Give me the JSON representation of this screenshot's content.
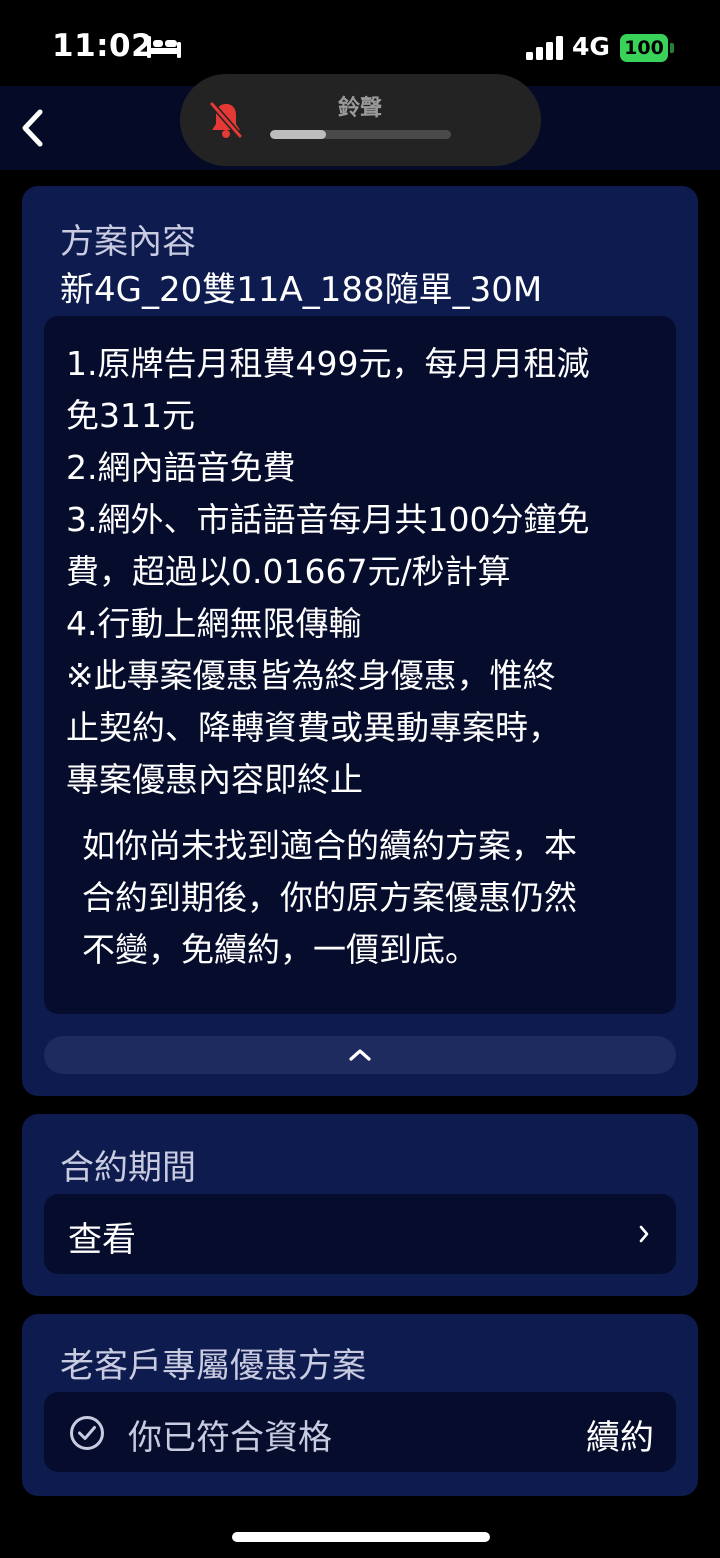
{
  "status_bar": {
    "time": "11:02",
    "network": "4G",
    "battery": "100",
    "battery_color": "#3ad35a"
  },
  "ringer": {
    "label": "鈴聲",
    "volume_fraction": 0.31
  },
  "plan": {
    "section_title": "方案內容",
    "name": "新4G_20雙11A_188隨單_30M",
    "details": [
      "1.原牌告月租費499元，每月月租減",
      "免311元",
      "2.網內語音免費",
      "3.網外、市話語音每月共100分鐘免",
      "費，超過以0.01667元/秒計算",
      "4.行動上網無限傳輸",
      "※此專案優惠皆為終身優惠，惟終",
      "止契約、降轉資費或異動專案時，",
      "專案優惠內容即終止"
    ],
    "renew_note": [
      "如你尚未找到適合的續約方案，本",
      "合約到期後，你的原方案優惠仍然",
      "不變，免續約，一價到底。"
    ]
  },
  "contract": {
    "section_title": "合約期間",
    "view_label": "查看"
  },
  "offer": {
    "section_title": "老客戶專屬優惠方案",
    "eligible_label": "你已符合資格",
    "renew_label": "續約"
  },
  "colors": {
    "card_bg": "#0d1b4f",
    "panel_bg": "#060d2c",
    "mute_red": "#e53935"
  },
  "icons": [
    "bed-icon",
    "signal-icon",
    "battery-icon",
    "back-chevron-icon",
    "bell-slash-icon",
    "chevron-up-icon",
    "chevron-right-icon",
    "check-circle-icon"
  ]
}
